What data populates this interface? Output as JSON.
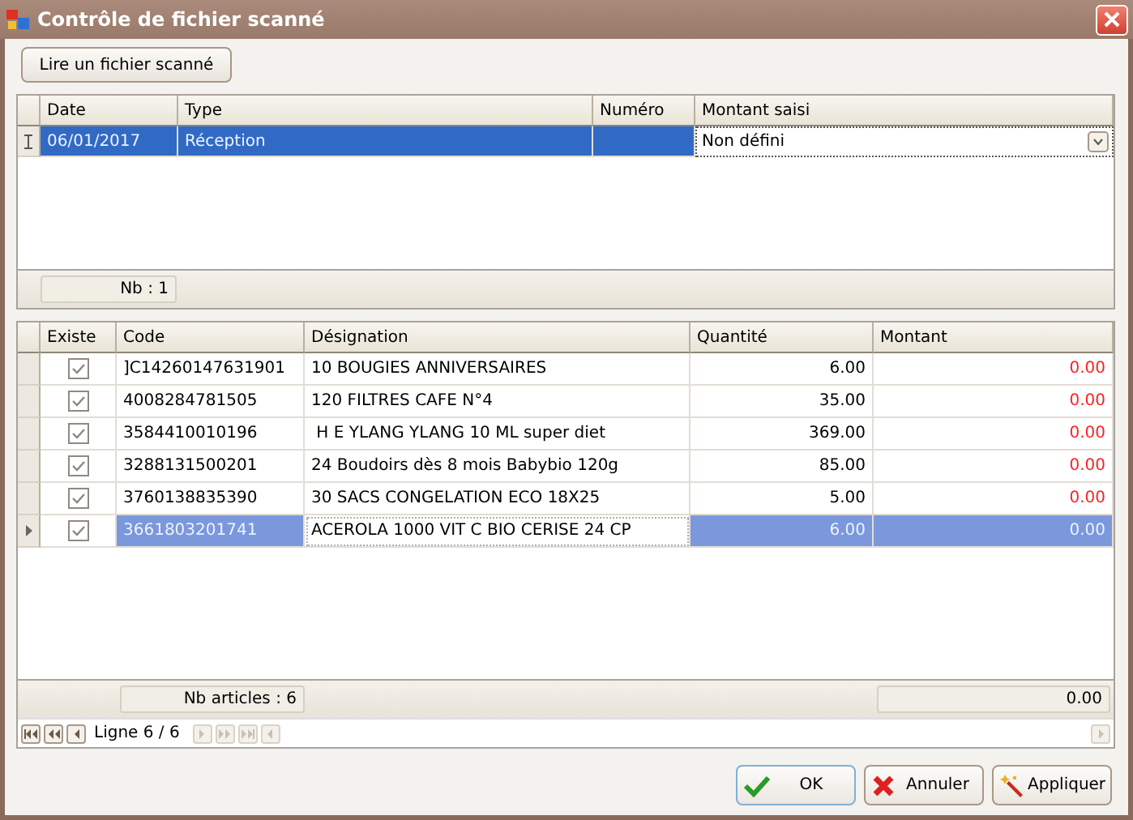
{
  "window": {
    "title": "Contrôle de fichier scanné"
  },
  "read_button": {
    "label": "Lire un fichier scanné"
  },
  "documents": {
    "columns": [
      "Date",
      "Type",
      "Numéro",
      "Montant saisi"
    ],
    "rows": [
      {
        "selected": true,
        "date": "06/01/2017",
        "type": "Réception",
        "amount_entry": "Non défini"
      }
    ],
    "footer": {
      "count": "Nb : 1"
    }
  },
  "articles": {
    "columns": [
      "Existe",
      "Code",
      "Désignation",
      "Quantité",
      "Montant"
    ],
    "rows": [
      {
        "selected": false,
        "designation_focused": false,
        "exists": true,
        "code": "]C14260147631901",
        "designation": "10 BOUGIES ANNIVERSAIRES",
        "quantity": "6.00",
        "amount": "0.00"
      },
      {
        "selected": false,
        "designation_focused": false,
        "exists": true,
        "code": "4008284781505",
        "designation": "120 FILTRES CAFE N°4",
        "quantity": "35.00",
        "amount": "0.00"
      },
      {
        "selected": false,
        "designation_focused": false,
        "exists": true,
        "code": "3584410010196",
        "designation": " H E YLANG YLANG 10 ML super diet",
        "quantity": "369.00",
        "amount": "0.00"
      },
      {
        "selected": false,
        "designation_focused": false,
        "exists": true,
        "code": "3288131500201",
        "designation": "24 Boudoirs dès 8 mois Babybio 120g",
        "quantity": "85.00",
        "amount": "0.00"
      },
      {
        "selected": false,
        "designation_focused": false,
        "exists": true,
        "code": "3760138835390",
        "designation": "30 SACS CONGELATION ECO 18X25",
        "quantity": "5.00",
        "amount": "0.00"
      },
      {
        "selected": true,
        "designation_focused": true,
        "exists": true,
        "code": "3661803201741",
        "designation": "ACEROLA 1000 VIT C BIO CERISE 24 CP",
        "quantity": "6.00",
        "amount": "0.00"
      }
    ],
    "footer": {
      "count": "Nb articles : 6",
      "total": "0.00"
    },
    "navigator": {
      "position": "Ligne 6 / 6"
    }
  },
  "buttons": [
    {
      "kind": "ok",
      "label": "OK"
    },
    {
      "kind": "cancel",
      "label": "Annuler"
    },
    {
      "kind": "apply",
      "label": "Appliquer"
    }
  ]
}
